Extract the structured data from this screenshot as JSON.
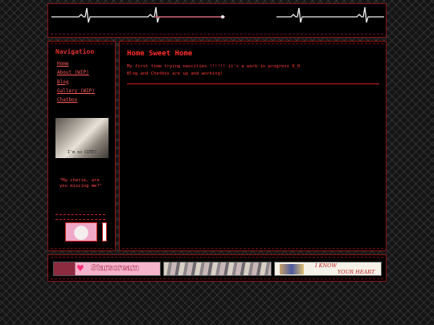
{
  "sidebar": {
    "title": "Navigation",
    "links": [
      "Home",
      "About (WIP)",
      "Blog",
      "Gallery (WIP)",
      "Chatbox"
    ],
    "image_caption": "I'm so CUTE?",
    "quote": "\"My cherie, are you missing me?\""
  },
  "main": {
    "title": "Home Sweet Home",
    "lines": [
      "My first time trying neocities !!!!!! it's a work in progress 0_0",
      "Blog and Chatbox are up and working!"
    ]
  },
  "footer": {
    "banner1_text": "Starscream",
    "banner3_line1": "I KNOW",
    "banner3_line2": "YOUR HEART"
  },
  "colors": {
    "accent": "#ff2d2d",
    "border": "#8a1414",
    "link": "#ff5a5a",
    "background": "#000000"
  }
}
